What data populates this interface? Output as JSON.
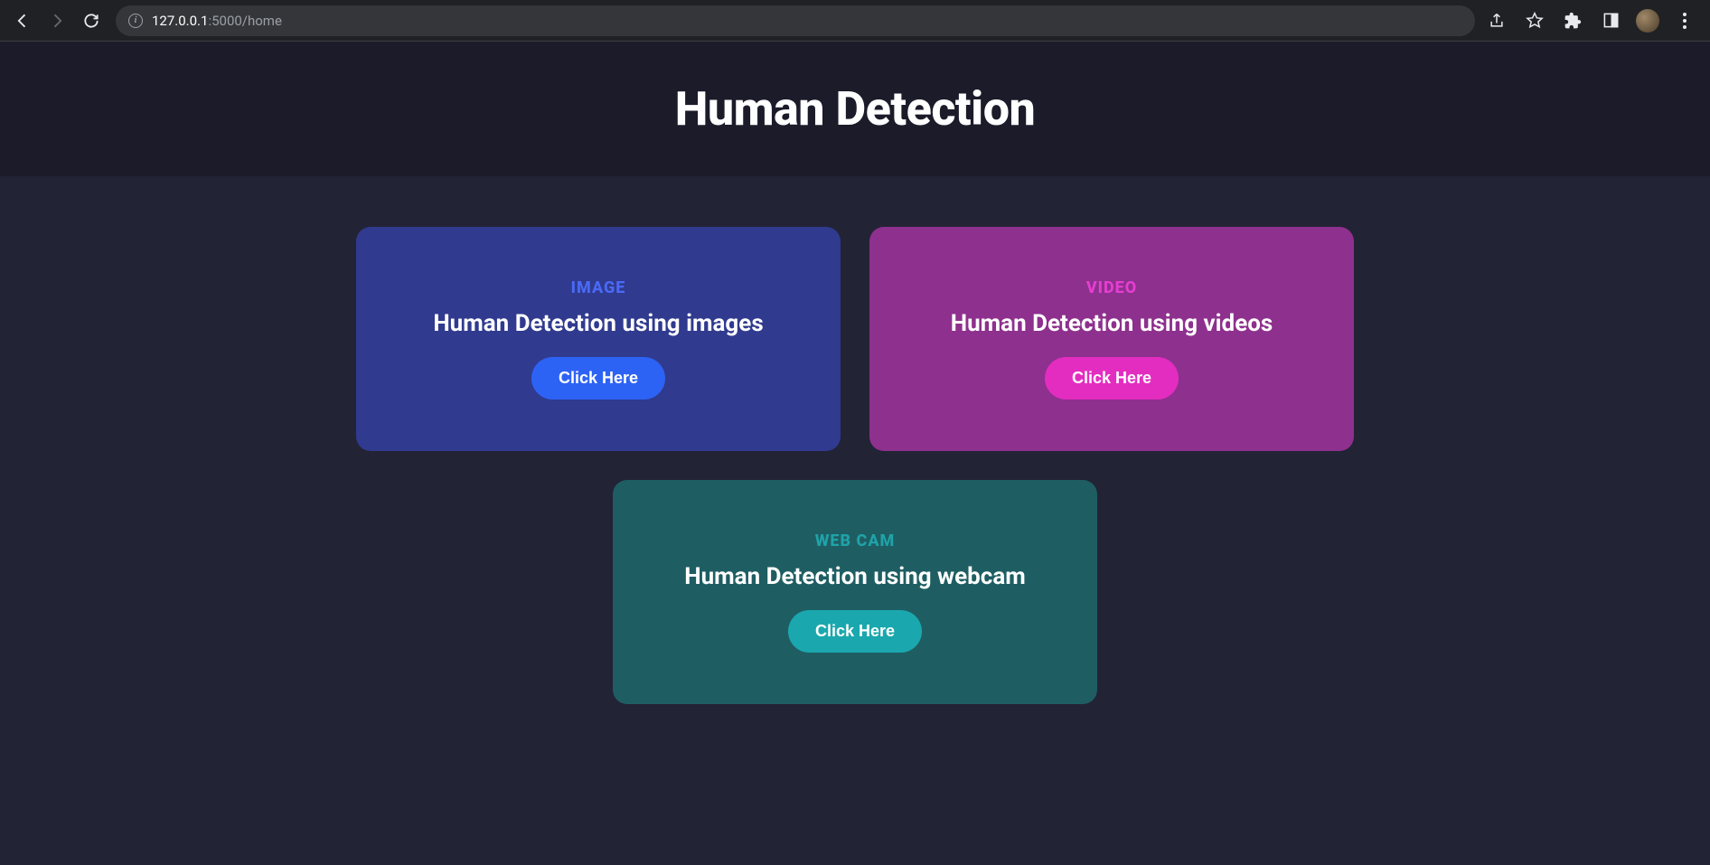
{
  "browser": {
    "url_host": "127.0.0.1",
    "url_path": ":5000/home"
  },
  "header": {
    "title": "Human Detection"
  },
  "cards": [
    {
      "label": "IMAGE",
      "description": "Human Detection using images",
      "button": "Click Here"
    },
    {
      "label": "VIDEO",
      "description": "Human Detection using videos",
      "button": "Click Here"
    },
    {
      "label": "WEB CAM",
      "description": "Human Detection using webcam",
      "button": "Click Here"
    }
  ]
}
